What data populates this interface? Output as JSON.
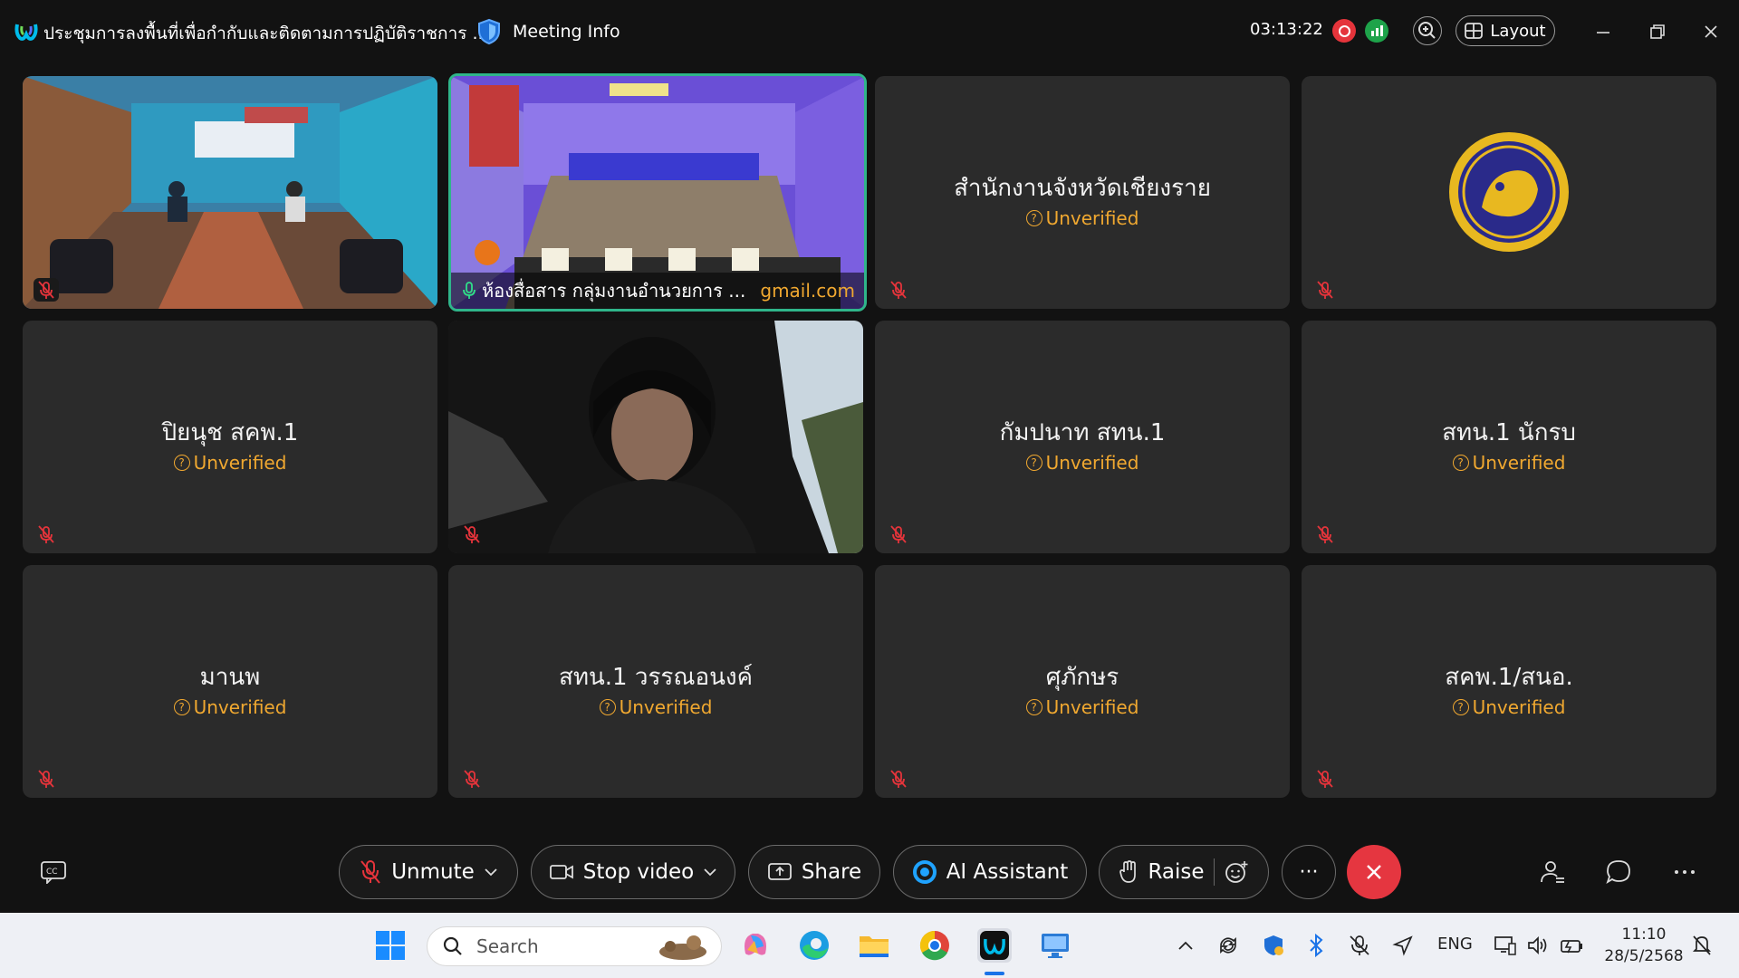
{
  "app": {
    "title": "ประชุมการลงพื้นที่เพื่อกำกับและติดตามการปฏิบัติราชการ ...",
    "meeting_info_label": "Meeting Info",
    "timer": "03:13:22",
    "layout_label": "Layout"
  },
  "tiles": [
    {
      "type": "video",
      "scene": "conference-room"
    },
    {
      "type": "video",
      "scene": "meeting-hall",
      "label": "ห้องสื่อสาร กลุ่มงานอำนวยการ ...",
      "email": "gmail.com"
    },
    {
      "type": "name",
      "name": "สำนักงานจังหวัดเชียงราย",
      "status": "Unverified"
    },
    {
      "type": "avatar",
      "avatar": "provincial-seal"
    },
    {
      "type": "name",
      "name": "ปิยนุช สคพ.1",
      "status": "Unverified"
    },
    {
      "type": "video",
      "scene": "car-interior"
    },
    {
      "type": "name",
      "name": "กัมปนาท สทน.1",
      "status": "Unverified"
    },
    {
      "type": "name",
      "name": "สทน.1 นักรบ",
      "status": "Unverified"
    },
    {
      "type": "name",
      "name": "มานพ",
      "status": "Unverified"
    },
    {
      "type": "name",
      "name": "สทน.1 วรรณอนงค์",
      "status": "Unverified"
    },
    {
      "type": "name",
      "name": "ศุภักษร",
      "status": "Unverified"
    },
    {
      "type": "name",
      "name": "สคพ.1/สนอ.",
      "status": "Unverified"
    }
  ],
  "toolbar": {
    "unmute_label": "Unmute",
    "stop_video_label": "Stop video",
    "share_label": "Share",
    "ai_assistant_label": "AI Assistant",
    "raise_label": "Raise",
    "more_label": "···"
  },
  "taskbar": {
    "search_placeholder": "Search",
    "language": "ENG",
    "time": "11:10",
    "date": "28/5/2568"
  },
  "colors": {
    "background": "#121212",
    "tile": "#2b2b2b",
    "unverified": "#f0a830",
    "active_border": "#2fb58a",
    "end_call": "#e53640",
    "mute_red": "#e5343b"
  }
}
